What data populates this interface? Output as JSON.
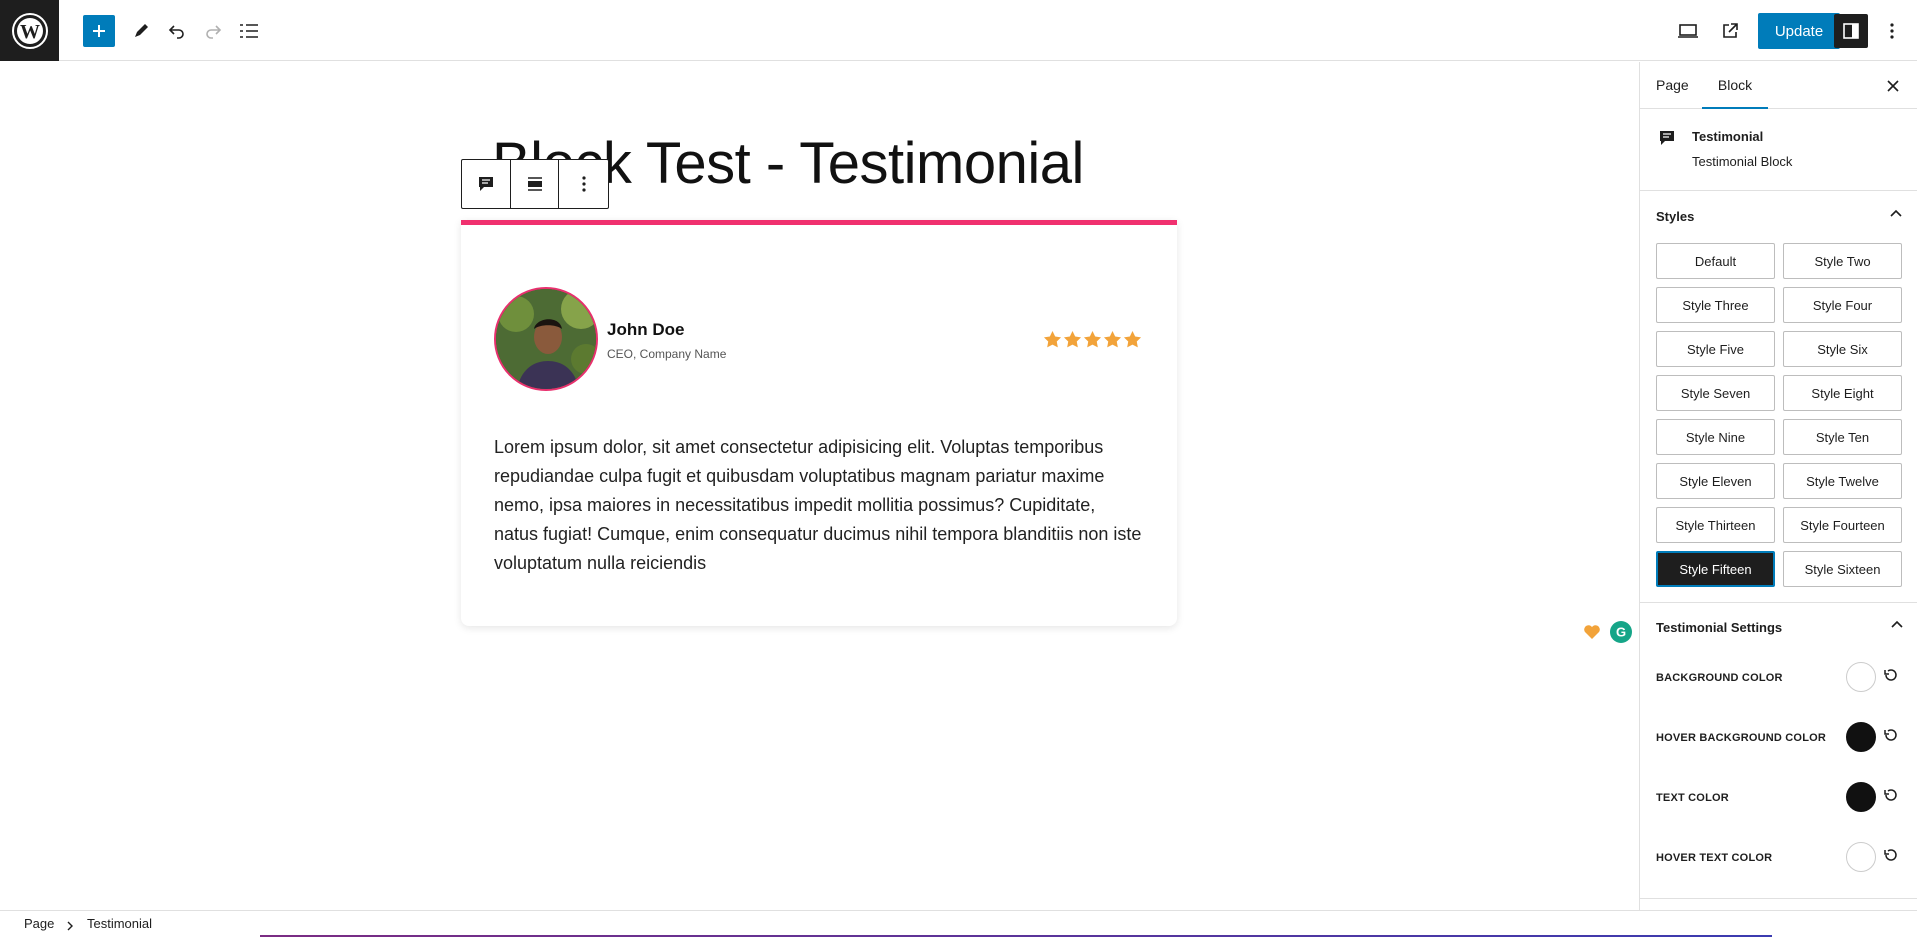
{
  "toolbar": {
    "update_label": "Update",
    "icons": [
      "wordpress-logo",
      "add-block",
      "edit-tools",
      "undo",
      "redo",
      "document-overview",
      "desktop-view",
      "external-preview",
      "settings",
      "options"
    ]
  },
  "editor": {
    "post_title": "Block Test - Testimonial",
    "block_toolbar_icons": [
      "testimonial-block-icon",
      "align-icon",
      "options-icon"
    ]
  },
  "testimonial": {
    "name": "John Doe",
    "role": "CEO, Company Name",
    "rating": 5,
    "rating_max": 5,
    "quote": "Lorem ipsum dolor, sit amet consectetur adipisicing elit. Voluptas temporibus repudiandae culpa fugit et quibusdam voluptatibus magnam pariatur maxime nemo, ipsa maiores in necessitatibus impedit mollitia possimus? Cupiditate, natus fugiat! Cumque, enim consequatur ducimus nihil tempora blanditiis non iste voluptatum nulla reiciendis",
    "accent_color": "#f0306f",
    "star_color": "#f2a33a"
  },
  "sidebar": {
    "tabs": [
      {
        "label": "Page"
      },
      {
        "label": "Block"
      }
    ],
    "block_card": {
      "title": "Testimonial",
      "description": "Testimonial Block"
    },
    "styles_panel": {
      "title": "Styles",
      "selected": "Style Fifteen",
      "options": [
        "Default",
        "Style Two",
        "Style Three",
        "Style Four",
        "Style Five",
        "Style Six",
        "Style Seven",
        "Style Eight",
        "Style Nine",
        "Style Ten",
        "Style Eleven",
        "Style Twelve",
        "Style Thirteen",
        "Style Fourteen",
        "Style Fifteen",
        "Style Sixteen"
      ]
    },
    "settings_panel": {
      "title": "Testimonial Settings",
      "colors": [
        {
          "label": "BACKGROUND COLOR",
          "value": "#ffffff"
        },
        {
          "label": "HOVER BACKGROUND COLOR",
          "value": "#111111"
        },
        {
          "label": "TEXT COLOR",
          "value": "#111111"
        },
        {
          "label": "HOVER TEXT COLOR",
          "value": "#ffffff"
        }
      ]
    }
  },
  "breadcrumb": {
    "items": [
      "Page",
      "Testimonial"
    ]
  },
  "colors": {
    "primary": "#007cba",
    "dark": "#1e1e1e"
  }
}
